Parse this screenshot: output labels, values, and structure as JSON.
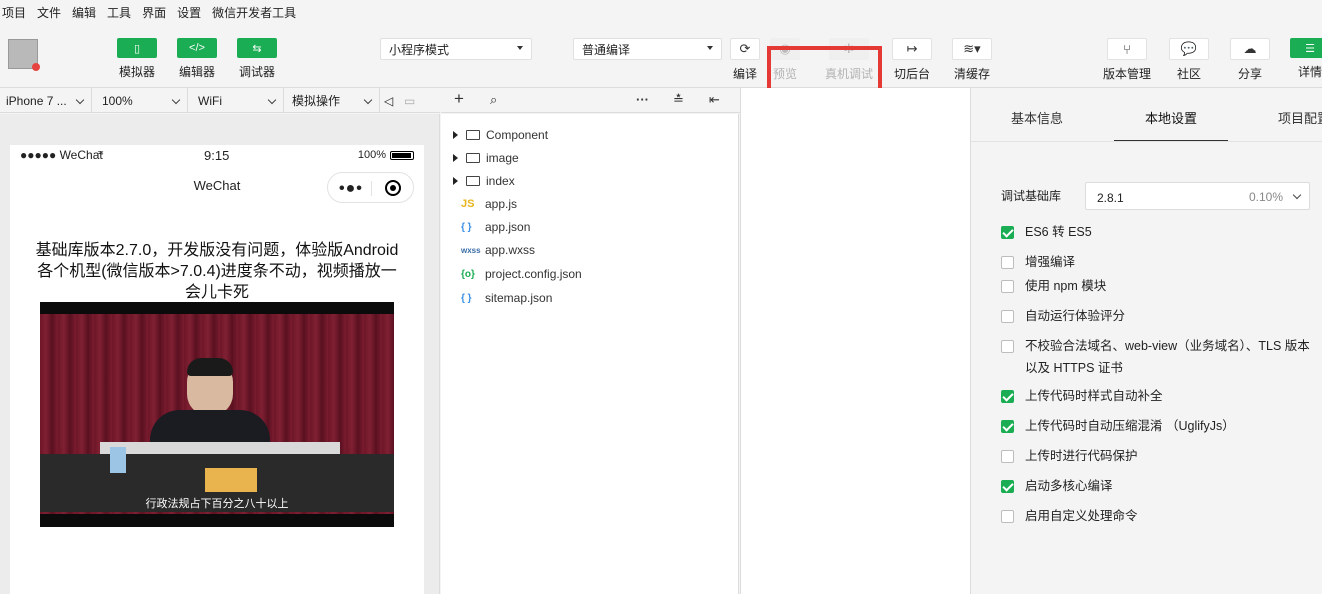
{
  "menubar": [
    "项目",
    "文件",
    "编辑",
    "工具",
    "界面",
    "设置",
    "微信开发者工具"
  ],
  "toolbar": {
    "simulator": "模拟器",
    "editor": "编辑器",
    "debugger": "调试器",
    "mode": "小程序模式",
    "compile_mode": "普通编译",
    "compile": "编译",
    "preview": "预览",
    "remote_debug": "真机调试",
    "background": "切后台",
    "clear_cache": "清缓存",
    "version": "版本管理",
    "community": "社区",
    "share": "分享",
    "details": "详情"
  },
  "simbar": {
    "device": "iPhone 7 ...",
    "zoom": "100%",
    "network": "WiFi",
    "operation": "模拟操作"
  },
  "phone": {
    "carrier": "●●●●● WeChat",
    "time": "9:15",
    "battery": "100%",
    "nav_title": "WeChat",
    "body_text": "基础库版本2.7.0，开发版没有问题，体验版Android各个机型(微信版本>7.0.4)进度条不动，视频播放一会儿卡死",
    "video_subtitle": "行政法规占下百分之八十以上"
  },
  "files": [
    {
      "type": "folder",
      "name": "Component"
    },
    {
      "type": "folder",
      "name": "image"
    },
    {
      "type": "folder",
      "name": "index"
    },
    {
      "type": "js",
      "icon": "JS",
      "name": "app.js"
    },
    {
      "type": "json",
      "icon": "{ }",
      "name": "app.json"
    },
    {
      "type": "wxss",
      "icon": "wxss",
      "name": "app.wxss"
    },
    {
      "type": "config",
      "icon": "{o}",
      "name": "project.config.json"
    },
    {
      "type": "json",
      "icon": "{ }",
      "name": "sitemap.json"
    }
  ],
  "panel": {
    "tabs": [
      "基本信息",
      "本地设置",
      "项目配置"
    ],
    "lib_label": "调试基础库",
    "lib_version": "2.8.1",
    "lib_percent": "0.10%",
    "options": [
      {
        "label": "ES6 转 ES5",
        "checked": true
      },
      {
        "label": "增强编译",
        "checked": false
      },
      {
        "label": "使用 npm 模块",
        "checked": false
      },
      {
        "label": "自动运行体验评分",
        "checked": false
      },
      {
        "label": "不校验合法域名、web-view（业务域名）、TLS 版本以及 HTTPS 证书",
        "checked": false
      },
      {
        "label": "上传代码时样式自动补全",
        "checked": true
      },
      {
        "label": "上传代码时自动压缩混淆 （UglifyJs）",
        "checked": true
      },
      {
        "label": "上传时进行代码保护",
        "checked": false
      },
      {
        "label": "启动多核心编译",
        "checked": true
      },
      {
        "label": "启用自定义处理命令",
        "checked": false
      }
    ]
  },
  "colors": {
    "accent": "#1aad53",
    "highlight": "#e53935"
  }
}
